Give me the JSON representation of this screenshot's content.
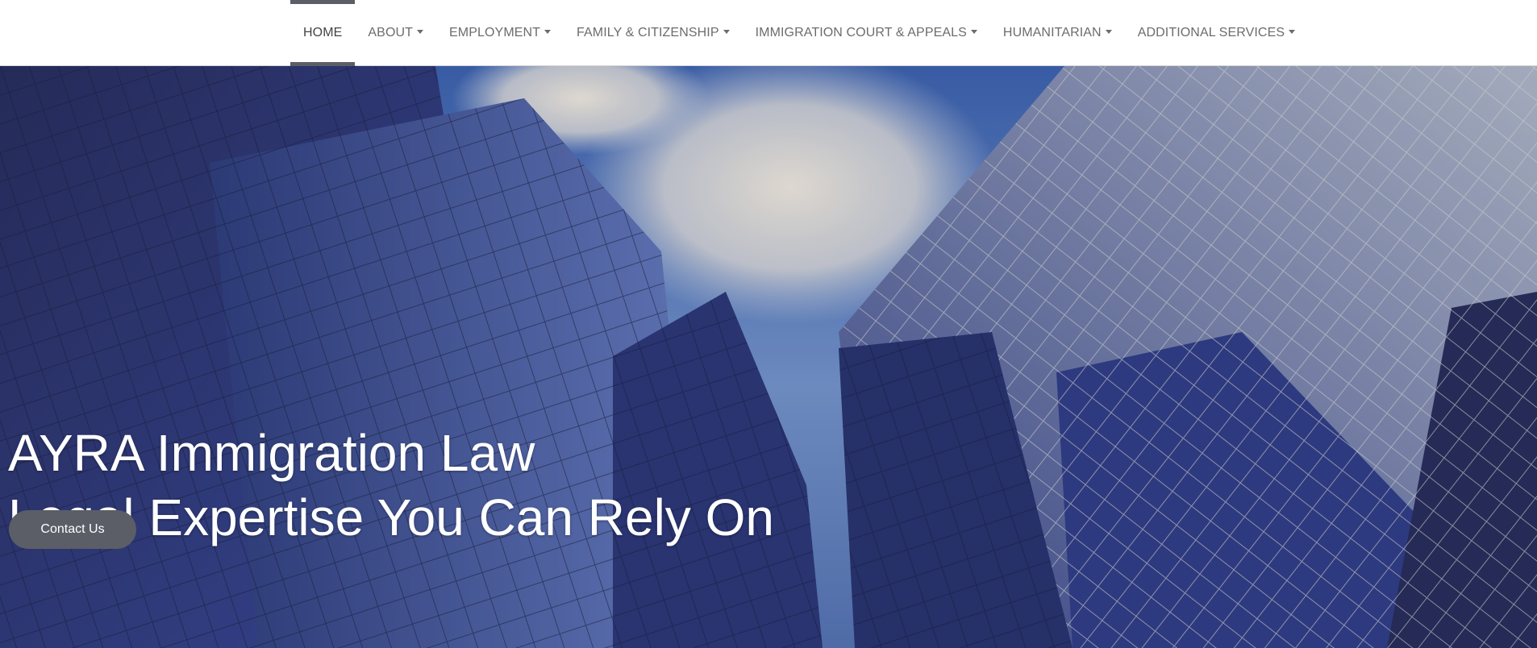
{
  "nav": {
    "items": [
      {
        "label": "HOME",
        "active": true,
        "has_dropdown": false
      },
      {
        "label": "ABOUT",
        "active": false,
        "has_dropdown": true
      },
      {
        "label": "EMPLOYMENT",
        "active": false,
        "has_dropdown": true
      },
      {
        "label": "FAMILY & CITIZENSHIP",
        "active": false,
        "has_dropdown": true
      },
      {
        "label": "IMMIGRATION COURT & APPEALS",
        "active": false,
        "has_dropdown": true
      },
      {
        "label": "HUMANITARIAN",
        "active": false,
        "has_dropdown": true
      },
      {
        "label": "ADDITIONAL SERVICES",
        "active": false,
        "has_dropdown": true
      }
    ]
  },
  "hero": {
    "title_line1": "AYRA Immigration Law",
    "title_line2": "Legal Expertise You Can Rely On",
    "cta_label": "Contact Us",
    "background_image": "glass-skyscrapers-looking-up-at-sky"
  },
  "colors": {
    "accent": "#5b5e66",
    "nav_text": "#6c6c6c",
    "hero_text": "#ffffff"
  }
}
